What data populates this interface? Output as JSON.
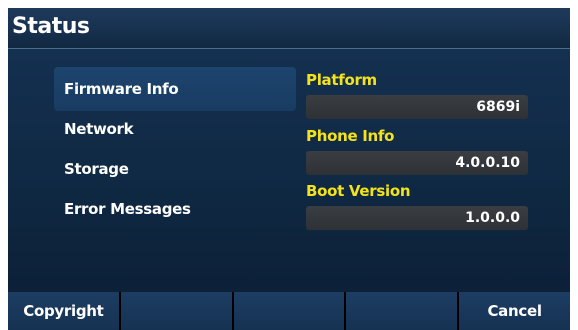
{
  "header": {
    "title": "Status"
  },
  "menu": {
    "items": [
      {
        "label": "Firmware Info",
        "selected": true
      },
      {
        "label": "Network",
        "selected": false
      },
      {
        "label": "Storage",
        "selected": false
      },
      {
        "label": "Error Messages",
        "selected": false
      }
    ]
  },
  "details": {
    "fields": [
      {
        "label": "Platform",
        "value": "6869i"
      },
      {
        "label": "Phone Info",
        "value": "4.0.0.10"
      },
      {
        "label": "Boot Version",
        "value": "1.0.0.0"
      }
    ]
  },
  "softkeys": {
    "keys": [
      {
        "label": "Copyright"
      },
      {
        "label": ""
      },
      {
        "label": ""
      },
      {
        "label": ""
      },
      {
        "label": "Cancel"
      }
    ]
  },
  "colors": {
    "accent_label": "#f4e21a",
    "selection": "#1d446e",
    "background": "#0f2842"
  }
}
